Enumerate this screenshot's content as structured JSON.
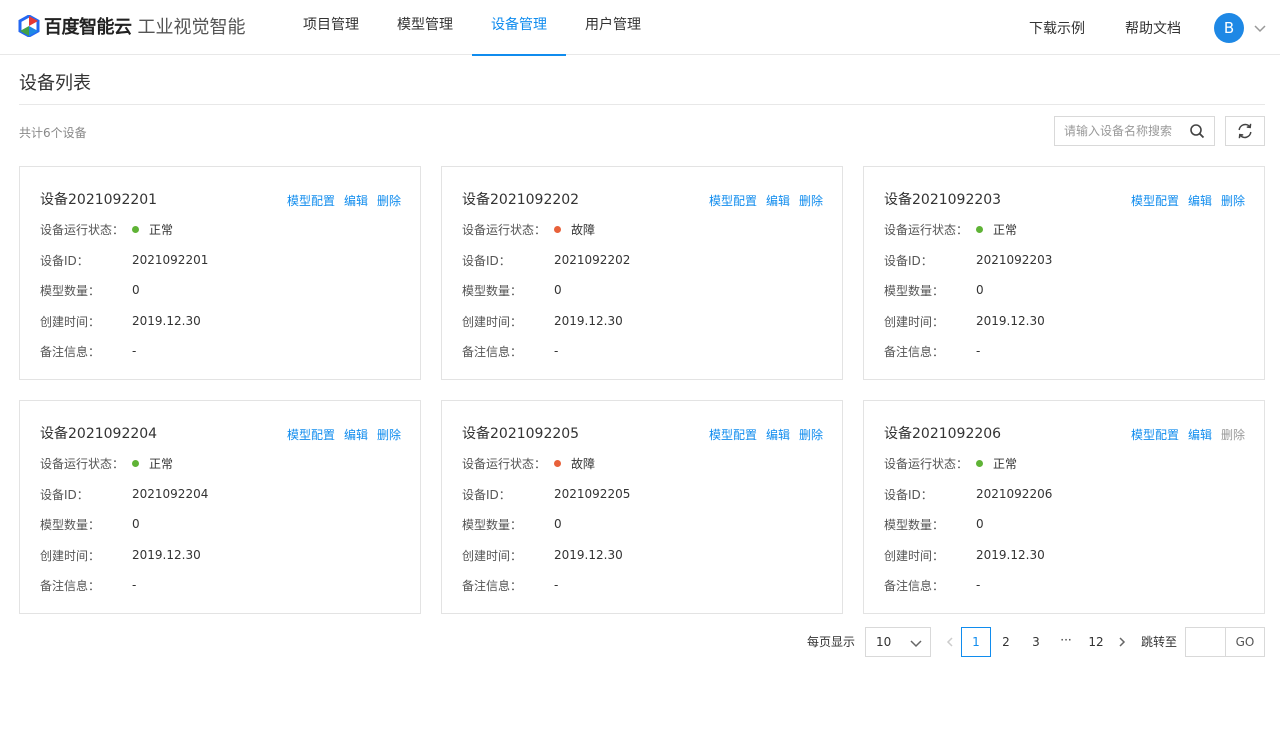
{
  "header": {
    "brand": "百度智能云",
    "product": "工业视觉智能",
    "nav": [
      {
        "label": "项目管理"
      },
      {
        "label": "模型管理"
      },
      {
        "label": "设备管理"
      },
      {
        "label": "用户管理"
      }
    ],
    "active_nav": "设备管理",
    "links": [
      "下载示例",
      "帮助文档"
    ],
    "avatar_letter": "B",
    "accent": "#108cee"
  },
  "page": {
    "title": "设备列表",
    "count_text": "共计6个设备",
    "search_placeholder": "请输入设备名称搜索"
  },
  "labels": {
    "status": "设备运行状态：",
    "id": "设备ID：",
    "model_count": "模型数量：",
    "created": "创建时间：",
    "remark": "备注信息："
  },
  "actions": {
    "config": "模型配置",
    "edit": "编辑",
    "delete": "删除"
  },
  "devices": [
    {
      "name": "设备2021092201",
      "status": "正常",
      "status_color": "#5fb336",
      "id": "2021092201",
      "model_count": "0",
      "created": "2019.12.30",
      "remark": "-"
    },
    {
      "name": "设备2021092202",
      "status": "故障",
      "status_color": "#e8613a",
      "id": "2021092202",
      "model_count": "0",
      "created": "2019.12.30",
      "remark": "-"
    },
    {
      "name": "设备2021092203",
      "status": "正常",
      "status_color": "#5fb336",
      "id": "2021092203",
      "model_count": "0",
      "created": "2019.12.30",
      "remark": "-"
    },
    {
      "name": "设备2021092204",
      "status": "正常",
      "status_color": "#5fb336",
      "id": "2021092204",
      "model_count": "0",
      "created": "2019.12.30",
      "remark": "-"
    },
    {
      "name": "设备2021092205",
      "status": "故障",
      "status_color": "#e8613a",
      "id": "2021092205",
      "model_count": "0",
      "created": "2019.12.30",
      "remark": "-"
    },
    {
      "name": "设备2021092206",
      "status": "正常",
      "status_color": "#5fb336",
      "id": "2021092206",
      "model_count": "0",
      "created": "2019.12.30",
      "remark": "-"
    }
  ],
  "pagination": {
    "per_page_label": "每页显示",
    "page_size": "10",
    "pages": [
      "1",
      "2",
      "3"
    ],
    "ellipsis": "···",
    "last_page": "12",
    "current": "1",
    "jump_label": "跳转至",
    "go_label": "GO"
  }
}
